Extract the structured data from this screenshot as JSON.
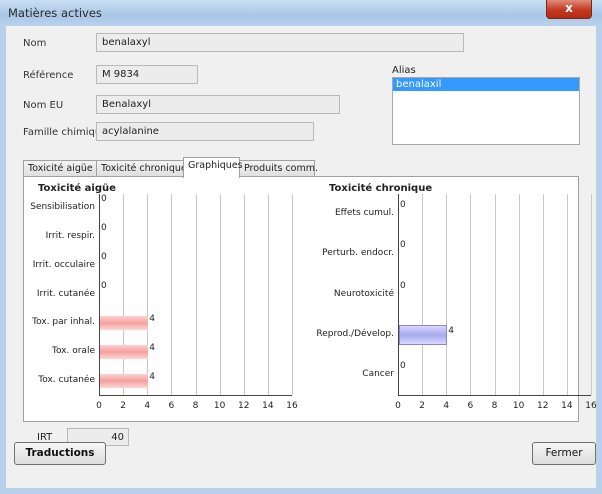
{
  "window": {
    "title": "Matières actives",
    "close_label": "x"
  },
  "form": {
    "nom_label": "Nom",
    "nom_value": "benalaxyl",
    "reference_label": "Référence",
    "reference_value": "M 9834",
    "nom_eu_label": "Nom EU",
    "nom_eu_value": "Benalaxyl",
    "famille_label": "Famille chimique",
    "famille_value": "acylalanine",
    "alias_label": "Alias",
    "alias_items": [
      "benalaxil"
    ]
  },
  "tabs": [
    {
      "label": "Toxicité aigüe",
      "active": false
    },
    {
      "label": "Toxicité chronique",
      "active": false
    },
    {
      "label": "Graphiques",
      "active": true
    },
    {
      "label": "Produits comm.",
      "active": false
    }
  ],
  "chart_data": [
    {
      "type": "bar",
      "orientation": "horizontal",
      "title": "Toxicité aigüe",
      "categories": [
        "Sensibilisation",
        "Irrit. respir.",
        "Irrit. occulaire",
        "Irrit. cutanée",
        "Tox. par inhal.",
        "Tox. orale",
        "Tox. cutanée"
      ],
      "values": [
        0,
        0,
        0,
        0,
        4,
        4,
        4
      ],
      "xlim": [
        0,
        16
      ],
      "xticks": [
        0,
        2,
        4,
        6,
        8,
        10,
        12,
        14,
        16
      ],
      "grid": true,
      "color": "#f4a0a0"
    },
    {
      "type": "bar",
      "orientation": "horizontal",
      "title": "Toxicité chronique",
      "categories": [
        "Effets cumul.",
        "Perturb. endocr.",
        "Neurotoxicité",
        "Reprod./Dévelop.",
        "Cancer"
      ],
      "values": [
        0,
        0,
        0,
        4,
        0
      ],
      "xlim": [
        0,
        16
      ],
      "xticks": [
        0,
        2,
        4,
        6,
        8,
        10,
        12,
        14,
        16
      ],
      "grid": true,
      "color": "#a8a8f0"
    }
  ],
  "irt": {
    "label": "IRT",
    "value": "40"
  },
  "buttons": {
    "traductions": "Traductions",
    "fermer": "Fermer"
  }
}
